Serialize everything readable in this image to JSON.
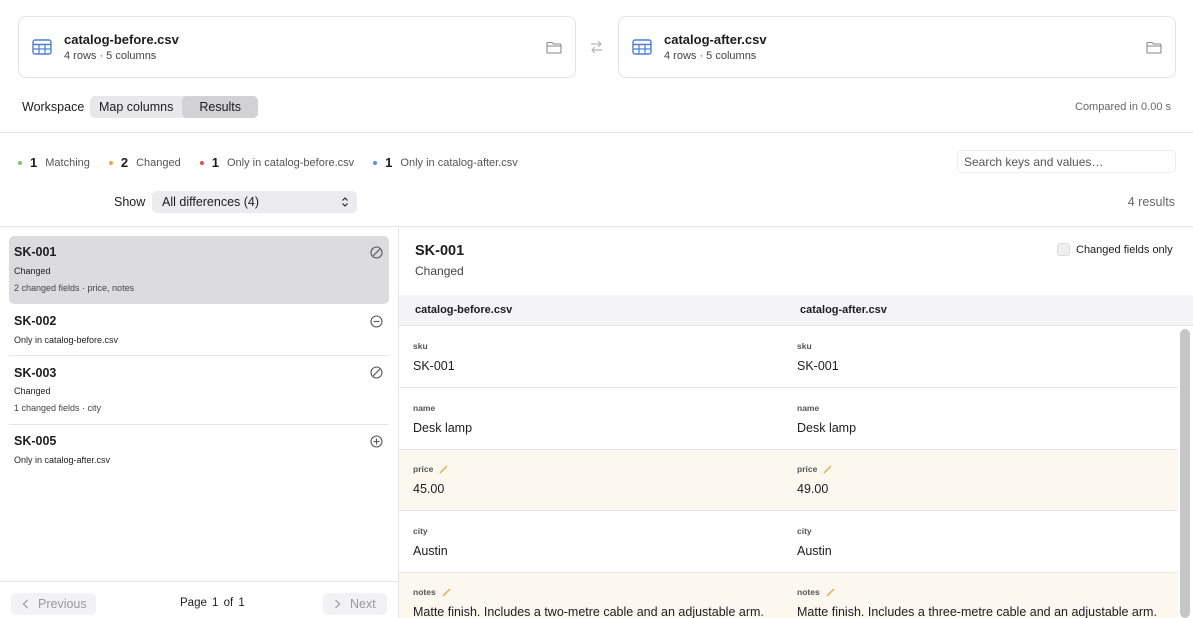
{
  "files": {
    "before": {
      "name": "catalog-before.csv",
      "meta": "4 rows · 5 columns"
    },
    "after": {
      "name": "catalog-after.csv",
      "meta": "4 rows · 5 columns"
    }
  },
  "toolbar": {
    "workspace_label": "Workspace",
    "tabs": [
      {
        "label": "Map columns",
        "active": false
      },
      {
        "label": "Results",
        "active": true
      }
    ],
    "compared": "Compared in 0.00 s"
  },
  "stats": [
    {
      "count": "1",
      "label": "Matching",
      "color": "#7cc36b"
    },
    {
      "count": "2",
      "label": "Changed",
      "color": "#e4a94b"
    },
    {
      "count": "1",
      "label": "Only in catalog-before.csv",
      "color": "#d9534f"
    },
    {
      "count": "1",
      "label": "Only in catalog-after.csv",
      "color": "#5b8fd6"
    }
  ],
  "search": {
    "placeholder": "Search keys and values…"
  },
  "filter": {
    "show_label": "Show",
    "selected": "All differences (4)"
  },
  "results_count": "4 results",
  "list": [
    {
      "key": "SK-001",
      "status": "Changed",
      "detail": "2 changed fields · price, notes",
      "icon": "changed-icon",
      "selected": true
    },
    {
      "key": "SK-002",
      "status": "Only in catalog-before.csv",
      "detail": "",
      "icon": "minus-circle-icon",
      "selected": false
    },
    {
      "key": "SK-003",
      "status": "Changed",
      "detail": "1 changed fields · city",
      "icon": "changed-icon",
      "selected": false
    },
    {
      "key": "SK-005",
      "status": "Only in catalog-after.csv",
      "detail": "",
      "icon": "plus-circle-icon",
      "selected": false
    }
  ],
  "pager": {
    "previous": "Previous",
    "next": "Next",
    "page_info": "Page 1 of 1"
  },
  "detail": {
    "key": "SK-001",
    "status": "Changed",
    "changed_only_label": "Changed fields only",
    "changed_only_checked": false,
    "left_header": "catalog-before.csv",
    "right_header": "catalog-after.csv",
    "fields": [
      {
        "name": "sku",
        "before": "SK-001",
        "after": "SK-001",
        "changed": false
      },
      {
        "name": "name",
        "before": "Desk lamp",
        "after": "Desk lamp",
        "changed": false
      },
      {
        "name": "price",
        "before": "45.00",
        "after": "49.00",
        "changed": true
      },
      {
        "name": "city",
        "before": "Austin",
        "after": "Austin",
        "changed": false
      },
      {
        "name": "notes",
        "before": "Matte finish. Includes a two-metre cable and an adjustable arm.",
        "after": "Matte finish. Includes a three-metre cable and an adjustable arm.",
        "changed": true
      }
    ]
  },
  "colors": {
    "accent_blue": "#4a7fd4",
    "changed_bg": "#fcf7ef",
    "changed_pencil": "#e4a94b"
  }
}
